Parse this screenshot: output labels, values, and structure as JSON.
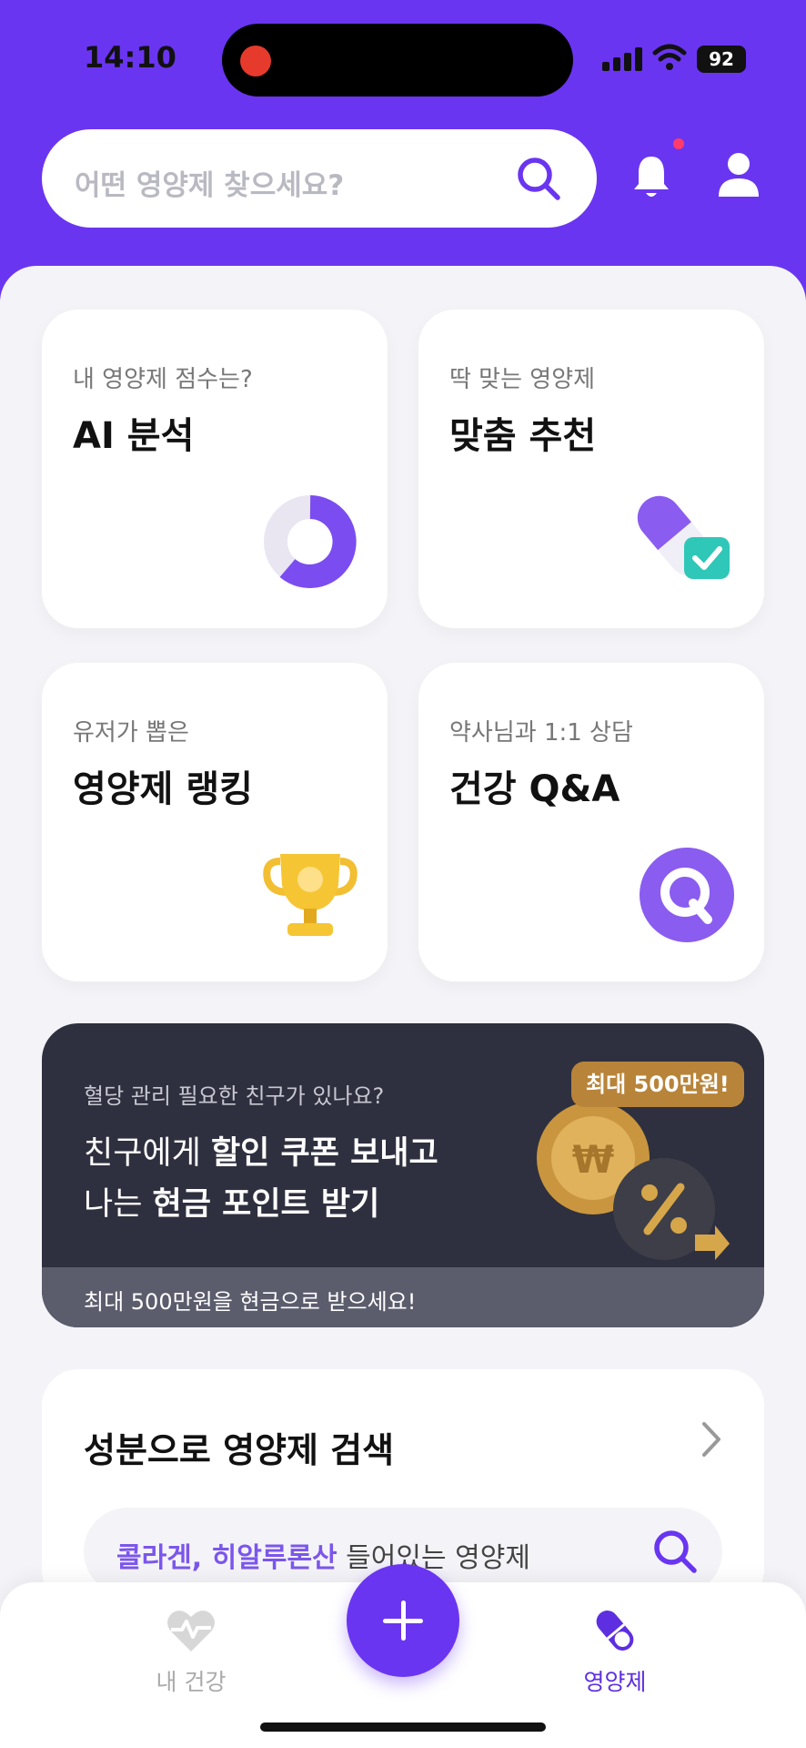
{
  "status_bar": {
    "time": "14:10",
    "battery": "92"
  },
  "header": {
    "search_placeholder": "어떤 영양제 찾으세요?",
    "icons": [
      "search-icon",
      "bell-icon",
      "user-icon"
    ],
    "accent_color": "#6a35f0"
  },
  "cards": [
    {
      "sub": "내 영양제 점수는?",
      "title": "AI 분석",
      "icon": "donut-chart-icon"
    },
    {
      "sub": "딱 맞는 영양제",
      "title": "맞춤 추천",
      "icon": "pill-check-icon"
    },
    {
      "sub": "유저가 뽑은",
      "title": "영양제 랭킹",
      "icon": "trophy-icon"
    },
    {
      "sub": "약사님과 1:1 상담",
      "title": "건강 Q&A",
      "icon": "q-badge-icon"
    }
  ],
  "banner": {
    "sub": "혈당 관리 필요한 친구가 있나요?",
    "line1_pre": "친구에게 ",
    "line1_bold": "할인 쿠폰 보내고",
    "line2_pre": "나는 ",
    "line2_bold": "현금 포인트 받기",
    "badge": "최대 500만원!",
    "footer": "최대 500만원을 현금으로 받으세요!"
  },
  "ingredient_search": {
    "title": "성분으로 영양제 검색",
    "highlight": "콜라겐, 히알루론산",
    "rest": " 들어있는 영양제"
  },
  "bottom_nav": {
    "items": [
      {
        "label": "내 건강",
        "icon": "heart-pulse-icon",
        "active": false
      },
      {
        "label": "영양제",
        "icon": "pill-icon",
        "active": true
      }
    ],
    "fab_icon": "plus-icon"
  }
}
